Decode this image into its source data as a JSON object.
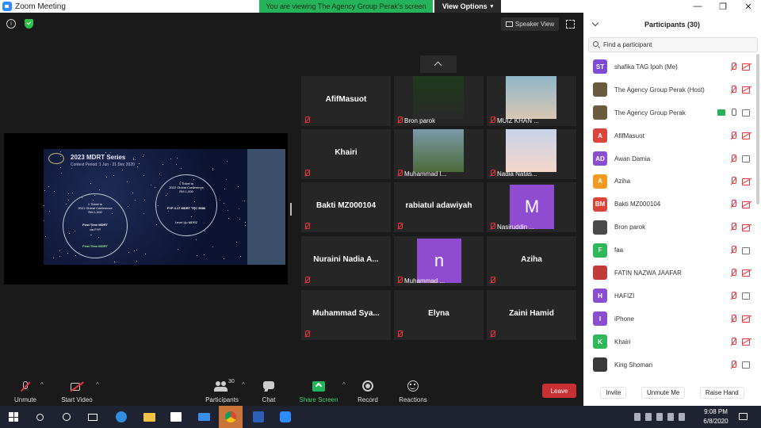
{
  "window": {
    "title": "Zoom Meeting",
    "viewing_banner": "You are viewing The Agency Group Perak's screen",
    "view_options": "View Options",
    "speaker_view": "Speaker View",
    "controls": [
      "—",
      "❐",
      "✕"
    ]
  },
  "gallery": [
    {
      "name": "AfifMasuot",
      "style": "big"
    },
    {
      "name": "Bron parok",
      "style": "video"
    },
    {
      "name": "MUIZ KHAN ...",
      "style": "video"
    },
    {
      "name": "Khairi",
      "style": "big"
    },
    {
      "name": "Muhammad I...",
      "style": "video"
    },
    {
      "name": "Nadia Natas...",
      "style": "video"
    },
    {
      "name": "Bakti MZ000104",
      "style": "big"
    },
    {
      "name": "rabiatul adawiyah",
      "style": "big"
    },
    {
      "name": "Nasiruddin ...",
      "style": "letter",
      "letter": "M"
    },
    {
      "name": "Nuraini Nadia A...",
      "style": "big"
    },
    {
      "name": "Muhammad ...",
      "style": "letter",
      "letter": "n"
    },
    {
      "name": "Aziha",
      "style": "big"
    },
    {
      "name": "Muhammad Sya...",
      "style": "big"
    },
    {
      "name": "Elyna",
      "style": "big"
    },
    {
      "name": "Zaini Hamid",
      "style": "big"
    }
  ],
  "shared_slide": {
    "title": "2023 MDRT Series",
    "subtitle": "Contest Period: 1 Jun - 31 Dec 2020",
    "left_circle": [
      "1 Ticket to",
      "2021 Global Conference",
      "RM 1,000",
      "First Time MDRT",
      "via FYP",
      "First Time MDRT"
    ],
    "right_circle": [
      "1 Ticket to",
      "2022 Global Conference",
      "RM 1,000",
      "FYP 4.17 MDRT TPC 5686",
      "Level Up MDRT"
    ]
  },
  "toolbar": {
    "unmute": "Unmute",
    "start_video": "Start Video",
    "participants": "Participants",
    "participants_count": "30",
    "chat": "Chat",
    "share_screen": "Share Screen",
    "record": "Record",
    "reactions": "Reactions",
    "leave": "Leave"
  },
  "panel": {
    "title": "Participants (30)",
    "search_placeholder": "Find a participant",
    "participants": [
      {
        "initials": "ST",
        "name": "shafika TAG Ipoh (Me)",
        "color": "#7f4bd0",
        "mic": "muted",
        "cam": "off"
      },
      {
        "initials": "",
        "name": "The Agency Group Perak (Host)",
        "color": "#6b5b3e",
        "mic": "muted",
        "cam": "off"
      },
      {
        "initials": "",
        "name": "The Agency Group Perak",
        "color": "#6b5b3e",
        "mic": "on",
        "cam": "on",
        "sharing": true
      },
      {
        "initials": "A",
        "name": "AfifMasuot",
        "color": "#d9453a",
        "mic": "muted",
        "cam": "off"
      },
      {
        "initials": "AD",
        "name": "Awan Damia",
        "color": "#8a4fcf",
        "mic": "muted",
        "cam": "on"
      },
      {
        "initials": "A",
        "name": "Aziha",
        "color": "#f29a1f",
        "mic": "muted",
        "cam": "off"
      },
      {
        "initials": "BM",
        "name": "Bakti MZ000104",
        "color": "#d9453a",
        "mic": "muted",
        "cam": "off"
      },
      {
        "initials": "",
        "name": "Bron parok",
        "color": "#4a4a4a",
        "mic": "muted",
        "cam": "off"
      },
      {
        "initials": "F",
        "name": "faa",
        "color": "#2fb85a",
        "mic": "muted",
        "cam": "on"
      },
      {
        "initials": "",
        "name": "FATIN NAZWA JAAFAR",
        "color": "#c23b3b",
        "mic": "muted",
        "cam": "off"
      },
      {
        "initials": "H",
        "name": "HAFIZI",
        "color": "#8a4fcf",
        "mic": "muted",
        "cam": "on"
      },
      {
        "initials": "I",
        "name": "iPhone",
        "color": "#8a4fcf",
        "mic": "muted",
        "cam": "off"
      },
      {
        "initials": "K",
        "name": "Khairi",
        "color": "#2fb85a",
        "mic": "muted",
        "cam": "off"
      },
      {
        "initials": "",
        "name": "King Shoman",
        "color": "#3a3a3a",
        "mic": "muted",
        "cam": "on"
      }
    ],
    "invite": "Invite",
    "unmute_me": "Unmute Me",
    "raise_hand": "Raise Hand"
  },
  "taskbar": {
    "time": "9:08 PM",
    "date": "6/8/2020"
  },
  "colors": {
    "accent_green": "#24b35a",
    "leave_red": "#c93033",
    "muted_red": "#e8343d"
  }
}
